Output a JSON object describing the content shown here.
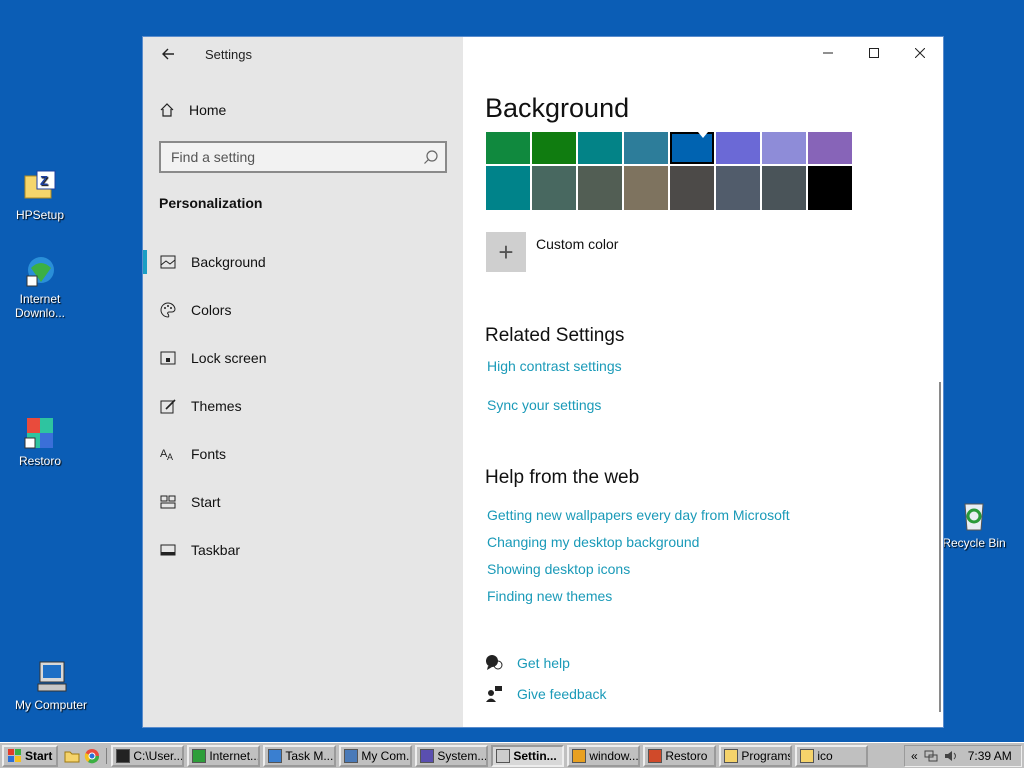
{
  "desktop": {
    "icons": [
      {
        "label": "HPSetup"
      },
      {
        "label": "Internet Downlo..."
      },
      {
        "label": "Restoro"
      },
      {
        "label": "My Computer"
      },
      {
        "label": "Recycle Bin"
      }
    ]
  },
  "window": {
    "title": "Settings",
    "home_label": "Home",
    "search_placeholder": "Find a setting",
    "section_heading": "Personalization",
    "nav": [
      {
        "label": "Background",
        "icon": "picture-icon",
        "active": true
      },
      {
        "label": "Colors",
        "icon": "palette-icon"
      },
      {
        "label": "Lock screen",
        "icon": "lock-screen-icon"
      },
      {
        "label": "Themes",
        "icon": "themes-icon"
      },
      {
        "label": "Fonts",
        "icon": "fonts-icon"
      },
      {
        "label": "Start",
        "icon": "start-icon"
      },
      {
        "label": "Taskbar",
        "icon": "taskbar-icon"
      }
    ]
  },
  "main": {
    "page_title": "Background",
    "swatches_row1": [
      "#10893e",
      "#107c10",
      "#038387",
      "#2d7d9a",
      "#0063b1",
      "#6b69d6",
      "#8e8cd8",
      "#8764b8"
    ],
    "swatches_row2": [
      "#00838a",
      "#486860",
      "#525e54",
      "#7e735f",
      "#4c4a48",
      "#515c6b",
      "#4a5459",
      "#000000"
    ],
    "selected_swatch": 4,
    "custom_color_label": "Custom color",
    "related_heading": "Related Settings",
    "related_links": [
      "High contrast settings",
      "Sync your settings"
    ],
    "help_heading": "Help from the web",
    "help_links": [
      "Getting new wallpapers every day from Microsoft",
      "Changing my desktop background",
      "Showing desktop icons",
      "Finding new themes"
    ],
    "get_help": "Get help",
    "give_feedback": "Give feedback"
  },
  "taskbar": {
    "start_label": "Start",
    "tasks": [
      {
        "label": "C:\\User...",
        "color": "#222222"
      },
      {
        "label": "Internet...",
        "color": "#2e9e3a"
      },
      {
        "label": "Task M...",
        "color": "#3a7fd0"
      },
      {
        "label": "My Com...",
        "color": "#4a7ab8"
      },
      {
        "label": "System...",
        "color": "#5a4fb0"
      },
      {
        "label": "Settin...",
        "color": "#cccccc",
        "active": true
      },
      {
        "label": "window...",
        "color": "#e8a020"
      },
      {
        "label": "Restoro",
        "color": "#d04a2a"
      },
      {
        "label": "Programs",
        "color": "#f5d36b"
      },
      {
        "label": "ico",
        "color": "#f5d36b"
      }
    ],
    "tray_chevron": "«",
    "clock": "7:39 AM"
  }
}
